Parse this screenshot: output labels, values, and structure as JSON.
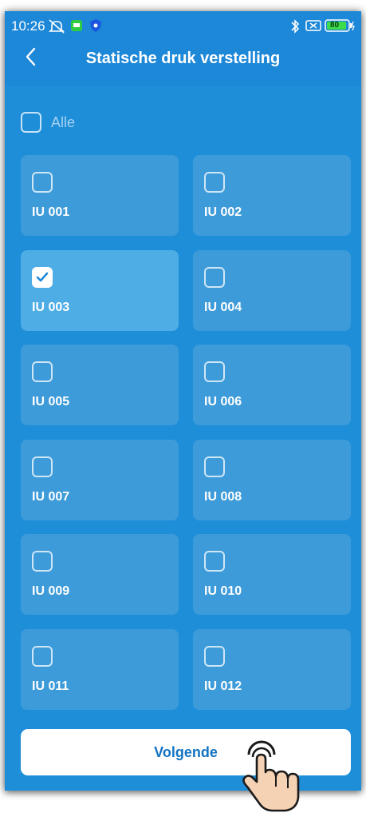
{
  "status_bar": {
    "time": "10:26",
    "battery": "80"
  },
  "header": {
    "title": "Statische druk verstelling"
  },
  "select_all": {
    "label": "Alle",
    "checked": false
  },
  "units": [
    {
      "label": "IU 001",
      "checked": false
    },
    {
      "label": "IU 002",
      "checked": false
    },
    {
      "label": "IU 003",
      "checked": true
    },
    {
      "label": "IU 004",
      "checked": false
    },
    {
      "label": "IU 005",
      "checked": false
    },
    {
      "label": "IU 006",
      "checked": false
    },
    {
      "label": "IU 007",
      "checked": false
    },
    {
      "label": "IU 008",
      "checked": false
    },
    {
      "label": "IU 009",
      "checked": false
    },
    {
      "label": "IU 010",
      "checked": false
    },
    {
      "label": "IU 011",
      "checked": false
    },
    {
      "label": "IU 012",
      "checked": false
    }
  ],
  "footer": {
    "next_label": "Volgende"
  },
  "colors": {
    "background": "#1e88d8",
    "tile": "#3d9bd9",
    "tile_selected": "#4fade6",
    "button_text": "#1272c2"
  }
}
